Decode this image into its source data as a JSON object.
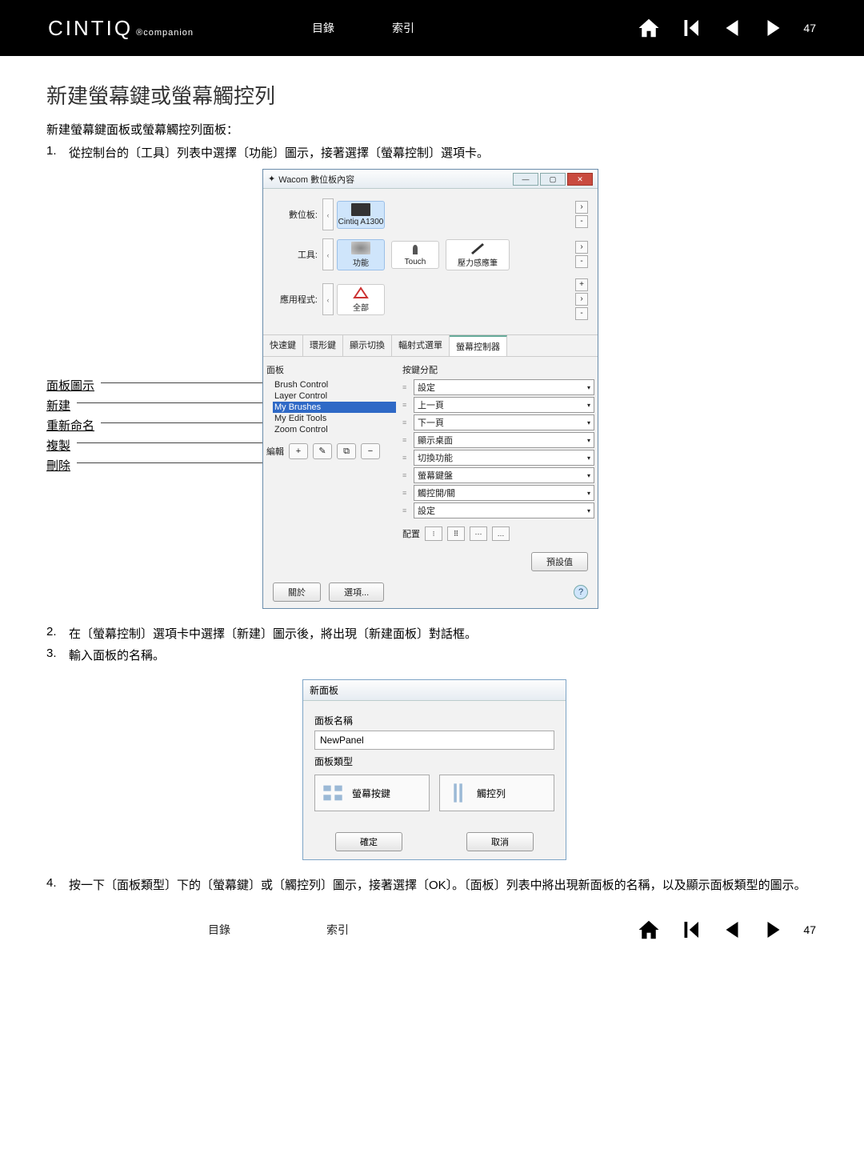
{
  "header": {
    "logo_main": "CINTIQ",
    "logo_sub": "®companion",
    "link_toc": "目錄",
    "link_index": "索引",
    "page_number": "47"
  },
  "title": "新建螢幕鍵或螢幕觸控列",
  "intro": "新建螢幕鍵面板或螢幕觸控列面板：",
  "steps": {
    "s1_num": "1.",
    "s1_text": "從控制台的〔工具〕列表中選擇〔功能〕圖示，接著選擇〔螢幕控制〕選項卡。",
    "s2_num": "2.",
    "s2_text": "在〔螢幕控制〕選項卡中選擇〔新建〕圖示後，將出現〔新建面板〕對話框。",
    "s3_num": "3.",
    "s3_text": "輸入面板的名稱。",
    "s4_num": "4.",
    "s4_text": "按一下〔面板類型〕下的〔螢幕鍵〕或〔觸控列〕圖示，接著選擇〔OK〕。〔面板〕列表中將出現新面板的名稱，以及顯示面板類型的圖示。"
  },
  "labels": {
    "panel_icon": "面板圖示",
    "new": "新建",
    "rename": "重新命名",
    "copy": "複製",
    "delete": "刪除"
  },
  "wacom_window": {
    "title": "Wacom 數位板內容",
    "row_tablet": "數位板:",
    "row_tool": "工具:",
    "row_app": "應用程式:",
    "dev1": "Cintiq A1300",
    "tool1": "功能",
    "tool2": "Touch",
    "tool3": "壓力感應筆",
    "app1": "全部",
    "tabs": [
      "快速鍵",
      "環形鍵",
      "顯示切換",
      "輻射式選單",
      "螢幕控制器"
    ],
    "panel_title": "面板",
    "assign_title": "按鍵分配",
    "panel_list": [
      "Brush Control",
      "Layer Control",
      "My Brushes",
      "My Edit Tools",
      "Zoom Control"
    ],
    "assignments": [
      "設定",
      "上一頁",
      "下一頁",
      "顯示桌面",
      "切換功能",
      "螢幕鍵盤",
      "觸控開/關",
      "設定"
    ],
    "edit_label": "編輯",
    "layout_label": "配置",
    "btn_default": "預設值",
    "btn_about": "關於",
    "btn_options": "選項..."
  },
  "new_panel_dialog": {
    "title": "新面板",
    "lbl_name": "面板名稱",
    "input_value": "NewPanel",
    "lbl_type": "面板類型",
    "type1": "螢幕按鍵",
    "type2": "觸控列",
    "btn_ok": "確定",
    "btn_cancel": "取消"
  },
  "footer": {
    "link_toc": "目錄",
    "link_index": "索引",
    "page_number": "47"
  }
}
